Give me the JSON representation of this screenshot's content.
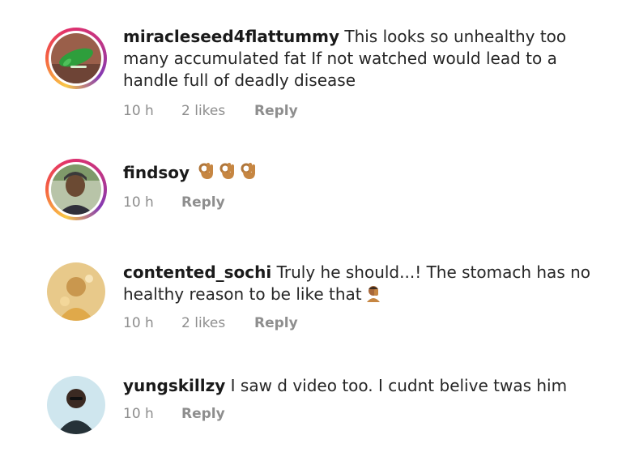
{
  "comments": [
    {
      "username": "miracleseed4flattummy",
      "text": "This looks so unhealthy too many accumulated fat If not watched would lead to a handle full of deadly disease",
      "time": "10 h",
      "likes": "2 likes",
      "reply": "Reply",
      "avatar_icon": "green-logo-avatar-icon",
      "has_story_ring": true
    },
    {
      "username": "findsoy",
      "text": "",
      "emoji": [
        "ok-hand-icon",
        "ok-hand-icon",
        "ok-hand-icon"
      ],
      "time": "10 h",
      "likes": "",
      "reply": "Reply",
      "avatar_icon": "person-photo-avatar-icon",
      "has_story_ring": true
    },
    {
      "username": "contented_sochi",
      "text": "Truly he should...! The stomach has no healthy reason to be like that",
      "emoji": [
        "person-facepalm-icon"
      ],
      "time": "10 h",
      "likes": "2 likes",
      "reply": "Reply",
      "avatar_icon": "person-photo-avatar-icon",
      "has_story_ring": false
    },
    {
      "username": "yungskillzy",
      "text": "I saw d video too. I cudnt belive twas him",
      "time": "10 h",
      "likes": "",
      "reply": "Reply",
      "avatar_icon": "person-photo-avatar-icon",
      "has_story_ring": false
    }
  ],
  "colors": {
    "meta_text": "#8e8e8e",
    "body_text": "#262626",
    "story_ring": "#e1306c",
    "emoji_skin": "#c68642"
  }
}
